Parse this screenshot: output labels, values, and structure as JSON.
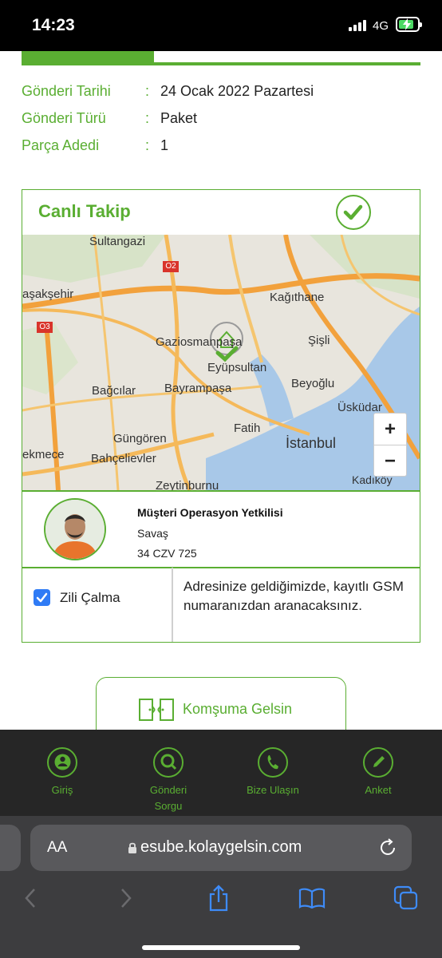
{
  "status_bar": {
    "time": "14:23",
    "network": "4G"
  },
  "shipment": {
    "rows": [
      {
        "label": "Gönderi Tarihi",
        "value": "24 Ocak 2022 Pazartesi"
      },
      {
        "label": "Gönderi Türü",
        "value": "Paket"
      },
      {
        "label": "Parça Adedi",
        "value": "1"
      }
    ],
    "separator": ":"
  },
  "live_tracking": {
    "title": "Canlı Takip",
    "map_labels": {
      "sultangazi": "Sultangazi",
      "basaksehir": "aşakşehir",
      "kagithane": "Kağıthane",
      "gaziosmanpasa": "Gaziosmanpaşa",
      "sisli": "Şişli",
      "eyupsultan": "Eyüpsultan",
      "bagcilar": "Bağcılar",
      "bayrampasa": "Bayrampaşa",
      "beyoglu": "Beyoğlu",
      "uskudar": "Üsküdar",
      "fatih": "Fatih",
      "gungoren": "Güngören",
      "istanbul": "İstanbul",
      "kcekmece": "ekmece",
      "bahcelievler": "Bahçelievler",
      "zeytinburnu": "Zeytinburnu",
      "kadikoy": "Kadıköy",
      "o2": "O2",
      "o3": "O3"
    },
    "zoom_in": "+",
    "zoom_out": "−"
  },
  "courier": {
    "title": "Müşteri Operasyon Yetkilisi",
    "name": "Savaş",
    "plate": "34 CZV 725"
  },
  "doorbell": {
    "checked": true,
    "label": "Zili Çalma",
    "description": "Adresinize geldiğimizde, kayıtlı GSM numaranızdan aranacaksınız."
  },
  "neighbor_button": {
    "label": "Komşuma Gelsin"
  },
  "bottom_nav": [
    {
      "label": "Giriş",
      "icon": "user-icon"
    },
    {
      "label": "Gönderi Sorgu",
      "icon": "search-icon"
    },
    {
      "label": "Bize Ulaşın",
      "icon": "phone-icon"
    },
    {
      "label": "Anket",
      "icon": "pencil-icon"
    }
  ],
  "browser": {
    "text_size_label": "AA",
    "url": "esube.kolaygelsin.com"
  },
  "colors": {
    "brand_green": "#5aae32",
    "nav_background": "#262626",
    "checkbox_blue": "#2f7bf5"
  }
}
